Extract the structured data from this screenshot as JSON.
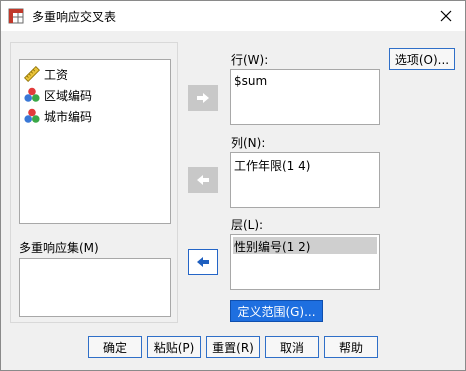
{
  "window": {
    "title": "多重响应交叉表"
  },
  "variables": [
    {
      "label": "工资",
      "icon": "scale-ruler-icon"
    },
    {
      "label": "区域编码",
      "icon": "nominal-balls-icon"
    },
    {
      "label": "城市编码",
      "icon": "nominal-balls-icon"
    }
  ],
  "mr_sets": {
    "label": "多重响应集(M)"
  },
  "rows": {
    "label": "行(W):",
    "items": [
      "$sum"
    ]
  },
  "columns": {
    "label": "列(N):",
    "items": [
      "工作年限(1 4)"
    ]
  },
  "layers": {
    "label": "层(L):",
    "items": [
      "性别编号(1 2)"
    ]
  },
  "buttons": {
    "options": "选项(O)...",
    "define_range": "定义范围(G)...",
    "ok": "确定",
    "paste": "粘贴(P)",
    "reset": "重置(R)",
    "cancel": "取消",
    "help": "帮助"
  }
}
